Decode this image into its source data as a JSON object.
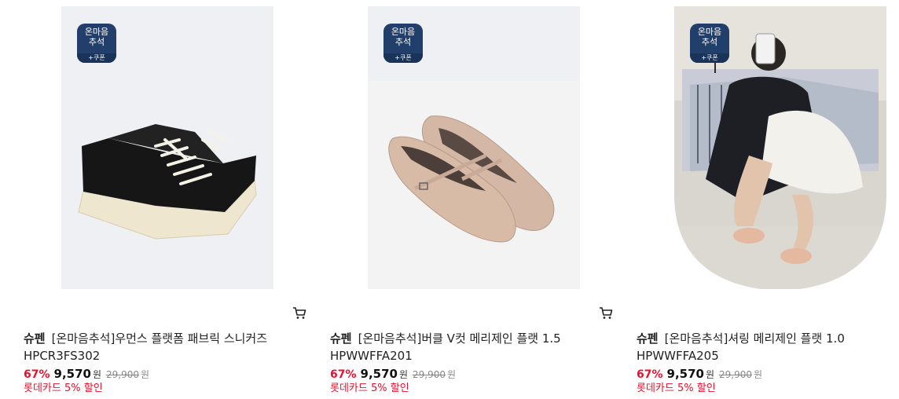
{
  "products": [
    {
      "badge": {
        "line1": "온마음",
        "line2": "추석",
        "coupon": "+쿠폰"
      },
      "brand": "슈펜",
      "title": "[온마음추석]우먼스 플랫폼 패브릭 스니커즈",
      "code": "HPCR3FS302",
      "discount": "67%",
      "price": "9,570",
      "won": "원",
      "original_price": "29,900",
      "card_promo": "롯데카드 5% 할인",
      "image": "black-platform-sneaker",
      "image_bg": "#eef0f4"
    },
    {
      "badge": {
        "line1": "온마음",
        "line2": "추석",
        "coupon": "+쿠폰"
      },
      "brand": "슈펜",
      "title": "[온마음추석]버클 V컷 메리제인 플랫 1.5",
      "code": "HPWWFFA201",
      "discount": "67%",
      "price": "9,570",
      "won": "원",
      "original_price": "29,900",
      "card_promo": "롯데카드 5% 할인",
      "image": "beige-patent-mary-jane-flat",
      "image_bg": "#eef0f4"
    },
    {
      "badge": {
        "line1": "온마음",
        "line2": "추석",
        "coupon": "+쿠폰"
      },
      "brand": "슈펜",
      "title": "[온마음추석]셔링 메리제인 플랫 1.0",
      "code": "HPWWFFA205",
      "discount": "67%",
      "price": "9,570",
      "won": "원",
      "original_price": "29,900",
      "card_promo": "롯데카드 5% 할인",
      "image": "model-mirror-selfie-photo",
      "image_bg": "#d9d6d0"
    }
  ],
  "colors": {
    "badge": "#223f6b",
    "discount": "#e8112d",
    "card_promo": "#e8112d"
  }
}
